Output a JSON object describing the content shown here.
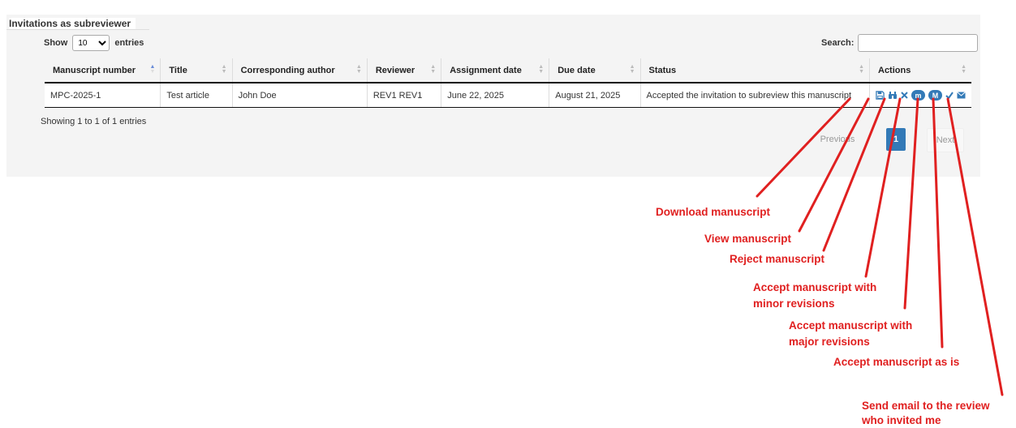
{
  "section_title": "Invitations as subreviewer",
  "length_control": {
    "prefix": "Show",
    "selected": "10",
    "suffix": "entries"
  },
  "search": {
    "label": "Search:",
    "value": ""
  },
  "table": {
    "headers": [
      "Manuscript number",
      "Title",
      "Corresponding author",
      "Reviewer",
      "Assignment date",
      "Due date",
      "Status",
      "Actions"
    ],
    "rows": [
      {
        "manuscript_number": "MPC-2025-1",
        "title": "Test article",
        "corresponding_author": "John Doe",
        "reviewer": "REV1 REV1",
        "assignment_date": "June 22, 2025",
        "due_date": "August 21, 2025",
        "status": "Accepted the invitation to subreview this manuscript"
      }
    ]
  },
  "action_icons": {
    "minor_label": "m",
    "major_label": "M"
  },
  "info": "Showing 1 to 1 of 1 entries",
  "pagination": {
    "previous": "Previous",
    "current": "1",
    "next": "Next"
  },
  "annotations": {
    "download": "Download manuscript",
    "view": "View manuscript",
    "reject": "Reject manuscript",
    "minor_1": "Accept manuscript with",
    "minor_2": "minor revisions",
    "major_1": "Accept manuscript with",
    "major_2": "major revisions",
    "as_is": "Accept manuscript as is",
    "email_1": "Send email to the review",
    "email_2": "who invited me"
  },
  "colors": {
    "accent": "#337ab7",
    "annotation": "#e02020"
  }
}
